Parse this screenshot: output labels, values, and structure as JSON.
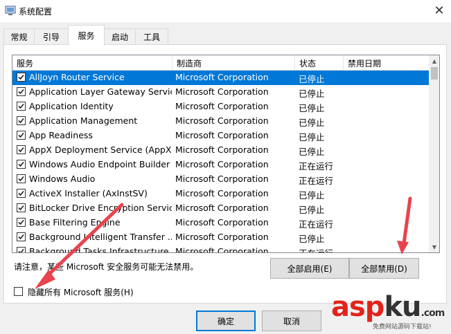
{
  "window": {
    "title": "系统配置",
    "close_glyph": "✕"
  },
  "tabs": [
    {
      "label": "常规",
      "active": false
    },
    {
      "label": "引导",
      "active": false
    },
    {
      "label": "服务",
      "active": true
    },
    {
      "label": "启动",
      "active": false
    },
    {
      "label": "工具",
      "active": false
    }
  ],
  "services": {
    "columns": [
      "服务",
      "制造商",
      "状态",
      "禁用日期"
    ],
    "rows": [
      {
        "name": "AllJoyn Router Service",
        "manufacturer": "Microsoft Corporation",
        "status": "已停止",
        "checked": true,
        "selected": true
      },
      {
        "name": "Application Layer Gateway Service",
        "manufacturer": "Microsoft Corporation",
        "status": "已停止",
        "checked": true
      },
      {
        "name": "Application Identity",
        "manufacturer": "Microsoft Corporation",
        "status": "已停止",
        "checked": true
      },
      {
        "name": "Application Management",
        "manufacturer": "Microsoft Corporation",
        "status": "已停止",
        "checked": true
      },
      {
        "name": "App Readiness",
        "manufacturer": "Microsoft Corporation",
        "status": "已停止",
        "checked": true
      },
      {
        "name": "AppX Deployment Service (AppX...",
        "manufacturer": "Microsoft Corporation",
        "status": "已停止",
        "checked": true
      },
      {
        "name": "Windows Audio Endpoint Builder",
        "manufacturer": "Microsoft Corporation",
        "status": "正在运行",
        "checked": true
      },
      {
        "name": "Windows Audio",
        "manufacturer": "Microsoft Corporation",
        "status": "正在运行",
        "checked": true
      },
      {
        "name": "ActiveX Installer (AxInstSV)",
        "manufacturer": "Microsoft Corporation",
        "status": "已停止",
        "checked": true
      },
      {
        "name": "BitLocker Drive Encryption Service",
        "manufacturer": "Microsoft Corporation",
        "status": "已停止",
        "checked": true
      },
      {
        "name": "Base Filtering Engine",
        "manufacturer": "Microsoft Corporation",
        "status": "正在运行",
        "checked": true
      },
      {
        "name": "Background Intelligent Transfer ...",
        "manufacturer": "Microsoft Corporation",
        "status": "已停止",
        "checked": true
      },
      {
        "name": "Background Tasks Infrastructure ...",
        "manufacturer": "Microsoft Corporation",
        "status": "正在运行",
        "checked": true
      }
    ]
  },
  "note": "请注意，某些 Microsoft 安全服务可能无法禁用。",
  "buttons": {
    "enable_all": "全部启用(E)",
    "disable_all": "全部禁用(D)",
    "ok": "确定",
    "cancel": "取消"
  },
  "hide_ms": {
    "label": "隐藏所有 Microsoft 服务(H)",
    "checked": false
  },
  "watermark": {
    "brand_a": "asp",
    "brand_b": "ku",
    "brand_c": ".com",
    "tagline": "免费网站源码下载站!"
  },
  "colors": {
    "selection": "#0078d7",
    "arrow": "#e8434e",
    "watermark_red": "#e2231a"
  }
}
